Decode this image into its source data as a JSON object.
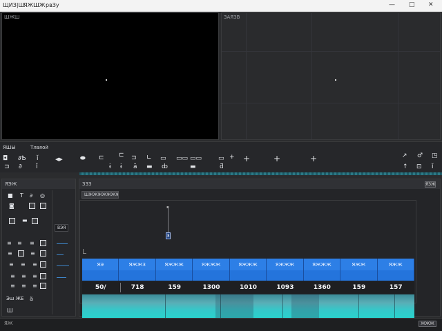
{
  "titlebar": {
    "menu_1": "ЩИЗ|Ш",
    "menu_2": "ЯЖШЖ",
    "menu_3": "рвЗy",
    "minimize": "—",
    "maximize": "□",
    "close": "✕"
  },
  "source_viewer": {
    "label": "ШЖШ"
  },
  "program_viewer": {
    "label": "ЗАЯЗВ"
  },
  "transport": {
    "label_1": "ЯШЫ",
    "label_2": "Тлвяой",
    "icons": [
      "play-icon",
      "step-back-icon",
      "loop-icon",
      "rewind-icon",
      "mark-in-icon",
      "mark-out-icon",
      "insert-icon",
      "overwrite-icon",
      "lift-icon",
      "extract-icon",
      "export-frame-icon",
      "crosshair-icon",
      "crosshair-icon",
      "crosshair-icon",
      "settings-icon",
      "settings-icon"
    ],
    "glyphs": {
      "g1": "◘",
      "g2": "∂Ѣ",
      "g3": "ǐ",
      "g4": "◀▶",
      "g5": "⬬",
      "g6": "⊏",
      "g7": "⊏",
      "g8": "⊐",
      "g9": "∟",
      "g10": "▭▭",
      "g11": "▭▭",
      "g12": "▭",
      "g13": "+",
      "g14": "+",
      "g15": "+",
      "g16": "↗",
      "g17": "♂",
      "g18": "◳",
      "g19": "⊐",
      "g20": "∂",
      "g21": "ǐ",
      "g22": "ɨ",
      "g23": "ɨ",
      "g24": "ä",
      "g25": "▬",
      "g26": "ȸ",
      "g27": "ƌ",
      "g28": "↑",
      "g29": "⊡",
      "g30": "ǐ",
      "g31": "▬",
      "g32": "ä"
    }
  },
  "tools_panel": {
    "header": "ЯЭЖ",
    "sub_label": "ВЭЯ",
    "footer": "Эш ЖЕ",
    "glyphs": [
      "■",
      "T",
      "∂",
      "◎",
      "◙",
      "▣",
      "▣",
      "▬",
      "◙",
      "≡",
      "≡",
      "≡",
      "▣",
      "≡",
      "▣",
      "≡",
      "≡",
      "≡",
      "▣",
      "Ш",
      "≡",
      "≡",
      "Ш",
      "ä"
    ]
  },
  "timeline": {
    "header": "ЗЗЗ",
    "button": "ШЖЖЖЖЖЖЖ",
    "corner": "ЯЗЖ",
    "playhead_label": "3",
    "clips": [
      "ЯЭ",
      "ЯЖЖЗ",
      "ЯЖЖЖ",
      "ЯЖЖЖ",
      "ЯЖЖЖ",
      "ЯЖЖЖ",
      "ЯЖЖЖ",
      "ЯЖЖ",
      "ЯЖЖ"
    ],
    "counts": [
      "50/",
      "718",
      "159",
      "1300",
      "1010",
      "1093",
      "1360",
      "159",
      "157"
    ]
  },
  "statusbar": {
    "left": "ЯЖ",
    "right": "ЖЖЖ"
  }
}
